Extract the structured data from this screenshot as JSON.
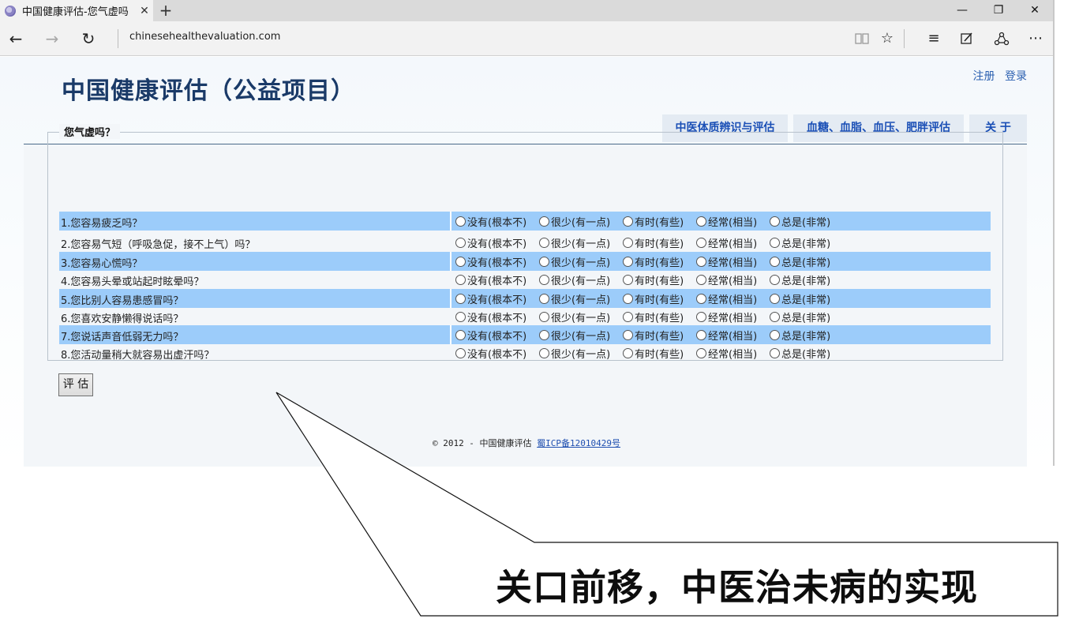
{
  "browser": {
    "tab_title": "中国健康评估-您气虚吗",
    "tab_close": "✕",
    "new_tab": "+",
    "url": "chinesehealthevaluation.com",
    "win_minimize": "—",
    "win_restore": "❐",
    "win_close": "✕"
  },
  "site": {
    "title": "中国健康评估（公益项目）",
    "auth": {
      "register": "注册",
      "login": "登录"
    },
    "nav": [
      {
        "label": "中医体质辨识与评估"
      },
      {
        "label": "血糖、血脂、血压、肥胖评估"
      },
      {
        "label": "关 于"
      }
    ]
  },
  "form": {
    "legend": "您气虚吗？",
    "options": [
      "没有(根本不)",
      "很少(有一点)",
      "有时(有些)",
      "经常(相当)",
      "总是(非常)"
    ],
    "questions": [
      "1.您容易疲乏吗？",
      "2.您容易气短（呼吸急促，接不上气）吗？",
      "3.您容易心慌吗？",
      "4.您容易头晕或站起时眩晕吗？",
      "5.您比别人容易患感冒吗？",
      "6.您喜欢安静懒得说话吗？",
      "7.您说话声音低弱无力吗？",
      "8.您活动量稍大就容易出虚汗吗？"
    ],
    "submit_label": "评 估"
  },
  "footer": {
    "copyright": "© 2012 - 中国健康评估",
    "icp": "蜀ICP备12010429号"
  },
  "callout": {
    "text": "关口前移，中医治未病的实现"
  }
}
